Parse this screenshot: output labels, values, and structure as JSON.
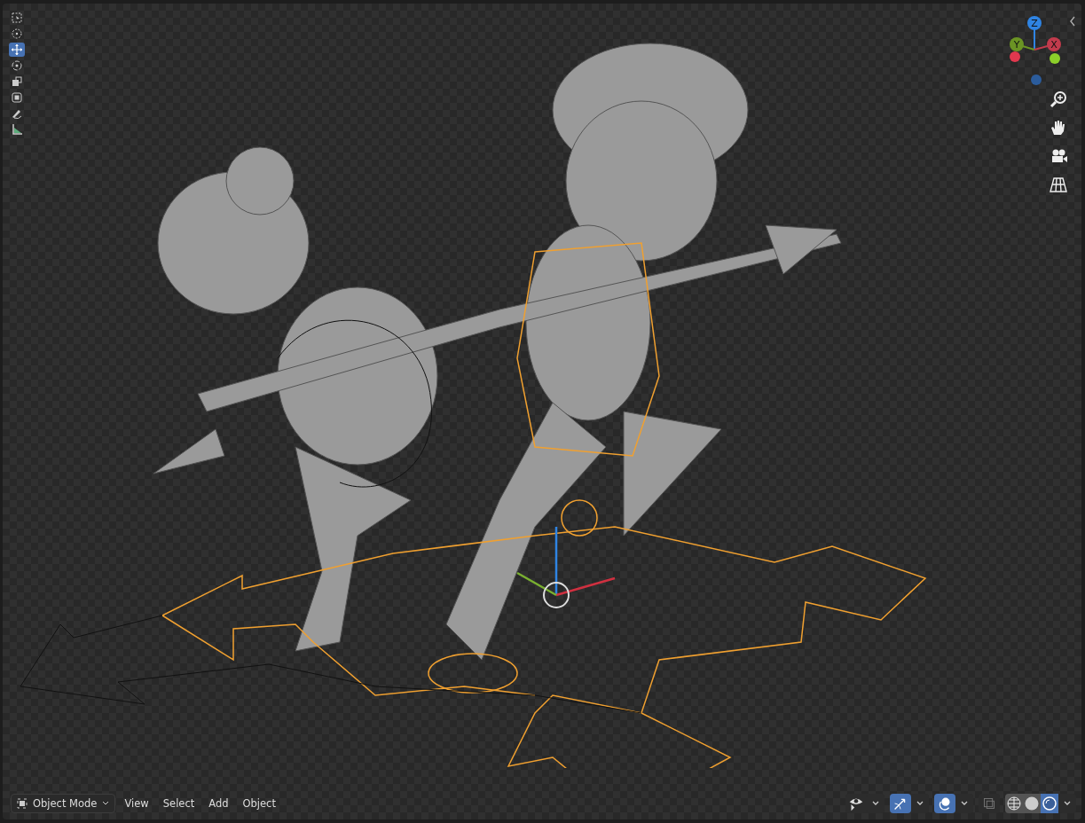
{
  "toolbar": {
    "tools": [
      {
        "kind": "select-box",
        "selected": false
      },
      {
        "kind": "cursor",
        "selected": false
      },
      {
        "kind": "move",
        "selected": true
      },
      {
        "kind": "rotate",
        "selected": false
      },
      {
        "kind": "scale",
        "selected": false
      },
      {
        "kind": "transform",
        "selected": false
      },
      {
        "kind": "annotate",
        "selected": false
      },
      {
        "kind": "measure",
        "selected": false
      }
    ]
  },
  "gizmo": {
    "axes": [
      {
        "label": "Z",
        "color": "#2f84e3"
      },
      {
        "label": "Y",
        "color": "#6b9424"
      },
      {
        "label": "X",
        "color": "#c13b4c"
      }
    ]
  },
  "navigation": [
    {
      "kind": "zoom"
    },
    {
      "kind": "pan"
    },
    {
      "kind": "camera"
    },
    {
      "kind": "perspective"
    }
  ],
  "header": {
    "mode": "Object Mode",
    "menus": [
      "View",
      "Select",
      "Add",
      "Object"
    ],
    "toggles": [
      {
        "kind": "visibility",
        "selected": false,
        "dropdown": true
      },
      {
        "kind": "gizmo",
        "selected": true,
        "dropdown": true
      },
      {
        "kind": "overlay",
        "selected": true,
        "dropdown": true
      },
      {
        "kind": "xray",
        "selected": false,
        "dropdown": false
      }
    ],
    "shading": [
      {
        "kind": "wireframe",
        "selected": false
      },
      {
        "kind": "solid",
        "selected": false
      },
      {
        "kind": "material",
        "selected": true
      }
    ]
  }
}
